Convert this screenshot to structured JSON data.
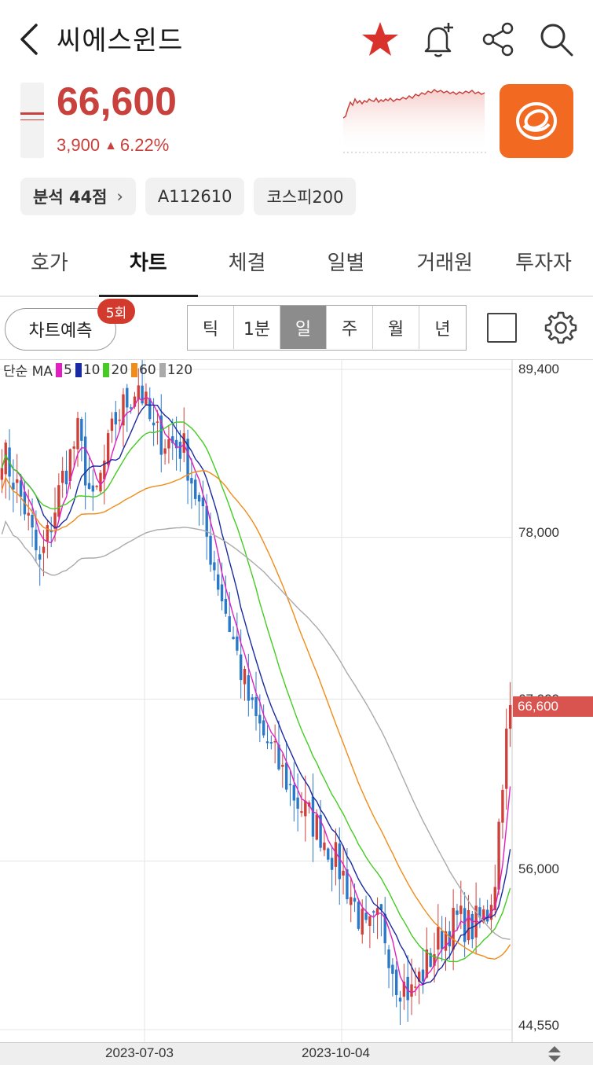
{
  "header": {
    "title": "씨에스윈드",
    "back_icon": "chevron-left-icon",
    "icons": [
      "star-icon",
      "bell-plus-icon",
      "share-icon",
      "search-icon"
    ],
    "star_color": "#d9322c"
  },
  "quote": {
    "price": "66,600",
    "change": "3,900",
    "change_pct": "6.22%",
    "direction": "up",
    "color": "#c9413c"
  },
  "chips": [
    {
      "label": "분석 44점",
      "has_arrow": true
    },
    {
      "label": "A112610"
    },
    {
      "label": "코스피200"
    }
  ],
  "tabs": [
    {
      "label": "호가"
    },
    {
      "label": "차트",
      "active": true
    },
    {
      "label": "체결"
    },
    {
      "label": "일별"
    },
    {
      "label": "거래원"
    },
    {
      "label": "투자자"
    }
  ],
  "toolbar": {
    "predict_label": "차트예측",
    "predict_badge": "5회",
    "periods": [
      "틱",
      "1분",
      "일",
      "주",
      "월",
      "년"
    ],
    "selected_period": "일"
  },
  "chart_data": {
    "type": "candlestick",
    "legend_prefix": "단순 MA",
    "ma_series": [
      {
        "name": "5",
        "color": "#e020c0"
      },
      {
        "name": "10",
        "color": "#1a2aa0"
      },
      {
        "name": "20",
        "color": "#44cc22"
      },
      {
        "name": "60",
        "color": "#f08c1a"
      },
      {
        "name": "120",
        "color": "#aaaaaa"
      }
    ],
    "y_ticks": [
      "89,400",
      "78,000",
      "67,000",
      "56,000",
      "44,550"
    ],
    "y_tick_values": [
      89400,
      78000,
      67000,
      56000,
      44550
    ],
    "ylim": [
      44550,
      89400
    ],
    "x_ticks": [
      "2023-07-03",
      "2023-10-04"
    ],
    "current_price_label": "66,600",
    "current_price": 66600,
    "approx_close_path": [
      [
        0,
        84000
      ],
      [
        6,
        80000
      ],
      [
        10,
        76000
      ],
      [
        16,
        82000
      ],
      [
        20,
        85000
      ],
      [
        24,
        80000
      ],
      [
        30,
        86000
      ],
      [
        36,
        88500
      ],
      [
        40,
        85000
      ],
      [
        44,
        84500
      ],
      [
        48,
        84000
      ],
      [
        50,
        82000
      ],
      [
        54,
        78000
      ],
      [
        58,
        74000
      ],
      [
        62,
        70000
      ],
      [
        66,
        66000
      ],
      [
        72,
        63000
      ],
      [
        78,
        60000
      ],
      [
        84,
        58000
      ],
      [
        90,
        55000
      ],
      [
        96,
        51000
      ],
      [
        100,
        52000
      ],
      [
        104,
        48000
      ],
      [
        108,
        47000
      ],
      [
        112,
        49000
      ],
      [
        116,
        51000
      ],
      [
        120,
        52000
      ],
      [
        124,
        51500
      ],
      [
        128,
        52500
      ],
      [
        130,
        55000
      ],
      [
        132,
        62000
      ],
      [
        134,
        66600
      ]
    ]
  }
}
